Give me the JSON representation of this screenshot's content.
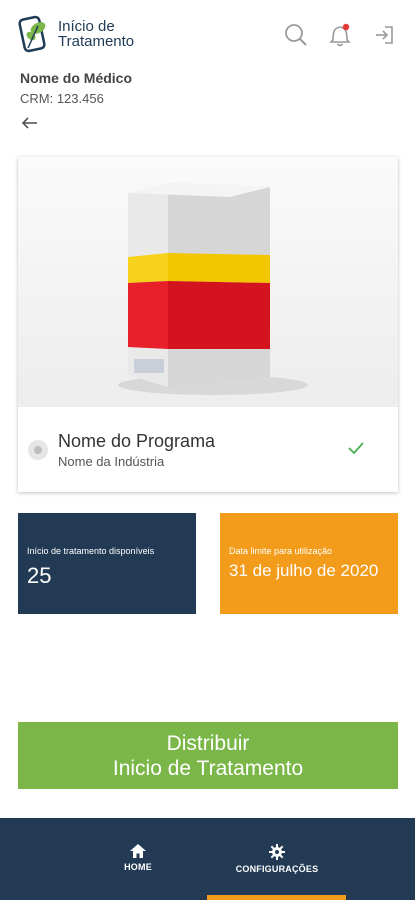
{
  "header": {
    "logo_line1": "Início de",
    "logo_line2": "Tratamento",
    "icons": [
      "search-icon",
      "bell-icon",
      "logout-icon"
    ],
    "has_notification": true
  },
  "doctor": {
    "name": "Nome do Médico",
    "crm": "CRM: 123.456"
  },
  "program": {
    "name": "Nome do Programa",
    "industry": "Nome da Indústria",
    "selected": true
  },
  "tiles": {
    "available_label": "Início de tratamento disponíveis",
    "available_value": "25",
    "deadline_label": "Data limite para utilização",
    "deadline_value": "31 de julho de 2020"
  },
  "action": {
    "line1": "Distribuir",
    "line2": "Inicio de Tratamento"
  },
  "nav": {
    "home_label": "HOME",
    "config_label": "CONFIGURAÇÕES",
    "active": "CONFIGURAÇÕES"
  },
  "colors": {
    "navy": "#233a55",
    "orange": "#f39b1a",
    "green": "#7ab648",
    "notification": "#e53935"
  }
}
